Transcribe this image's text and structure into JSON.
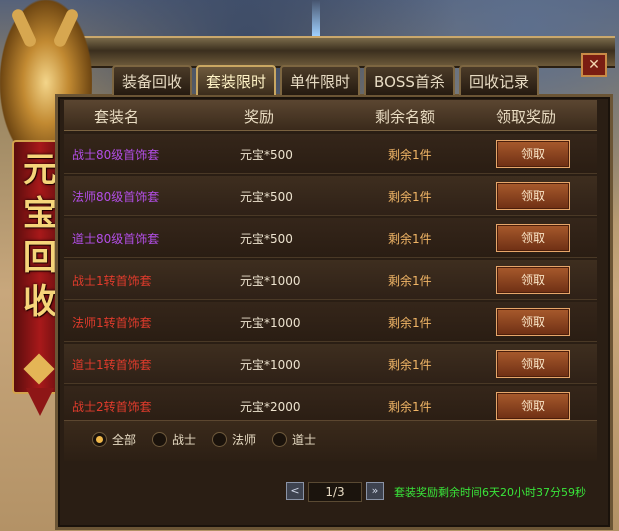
{
  "tabs": [
    {
      "label": "装备回收",
      "active": false
    },
    {
      "label": "套装限时",
      "active": true
    },
    {
      "label": "单件限时",
      "active": false
    },
    {
      "label": "BOSS首杀",
      "active": false
    },
    {
      "label": "回收记录",
      "active": false
    }
  ],
  "close_label": "✕",
  "banner_chars": [
    "元",
    "宝",
    "回",
    "收"
  ],
  "header": {
    "name": "套装名",
    "reward": "奖励",
    "remaining": "剩余名额",
    "claim": "领取奖励"
  },
  "rows": [
    {
      "name": "战士80级首饰套",
      "reward": "元宝*500",
      "remaining": "剩余1件",
      "button": "领取",
      "name_color": "#b24ee6"
    },
    {
      "name": "法师80级首饰套",
      "reward": "元宝*500",
      "remaining": "剩余1件",
      "button": "领取",
      "name_color": "#b24ee6"
    },
    {
      "name": "道士80级首饰套",
      "reward": "元宝*500",
      "remaining": "剩余1件",
      "button": "领取",
      "name_color": "#b24ee6"
    },
    {
      "name": "战士1转首饰套",
      "reward": "元宝*1000",
      "remaining": "剩余1件",
      "button": "领取",
      "name_color": "#e03b2c"
    },
    {
      "name": "法师1转首饰套",
      "reward": "元宝*1000",
      "remaining": "剩余1件",
      "button": "领取",
      "name_color": "#e03b2c"
    },
    {
      "name": "道士1转首饰套",
      "reward": "元宝*1000",
      "remaining": "剩余1件",
      "button": "领取",
      "name_color": "#e03b2c"
    },
    {
      "name": "战士2转首饰套",
      "reward": "元宝*2000",
      "remaining": "剩余1件",
      "button": "领取",
      "name_color": "#e03b2c"
    }
  ],
  "filters": [
    {
      "label": "全部",
      "selected": true
    },
    {
      "label": "战士",
      "selected": false
    },
    {
      "label": "法师",
      "selected": false
    },
    {
      "label": "道士",
      "selected": false
    }
  ],
  "pagination": {
    "prev": "<",
    "current": "1/3",
    "next": "»"
  },
  "timer_text": "套装奖励剩余时间6天20小时37分59秒",
  "colors": {
    "timer": "#39e63a",
    "remaining": "#f0b566",
    "accent": "#c9a762"
  }
}
